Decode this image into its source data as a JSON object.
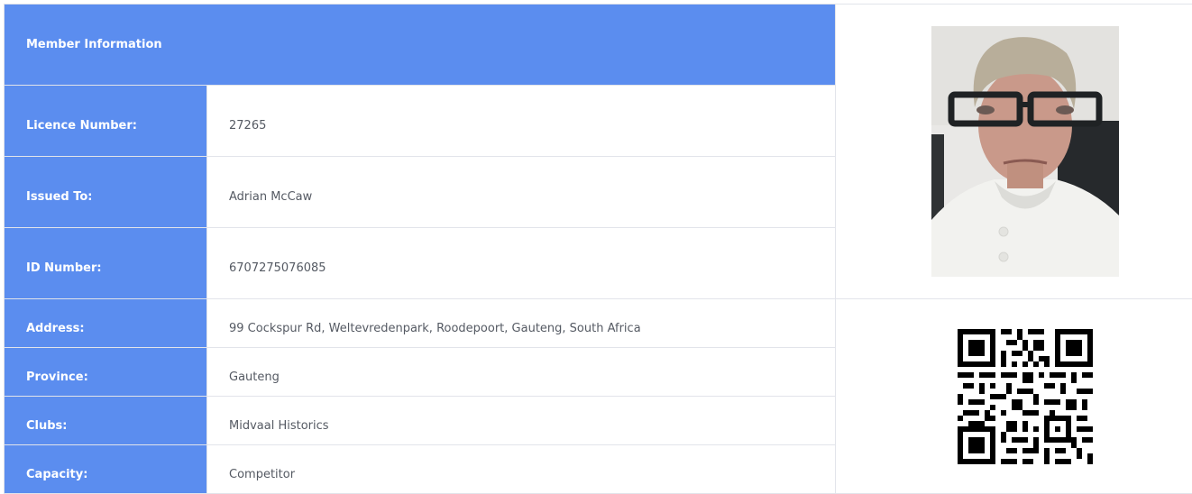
{
  "title": "Member Information",
  "rows": [
    {
      "label": "Licence Number:",
      "value": "27265"
    },
    {
      "label": "Issued To:",
      "value": "Adrian McCaw"
    },
    {
      "label": "ID Number:",
      "value": "6707275076085"
    },
    {
      "label": "Address:",
      "value": "99 Cockspur Rd, Weltevredenpark, Roodepoort, Gauteng, South Africa"
    },
    {
      "label": "Province:",
      "value": "Gauteng"
    },
    {
      "label": "Clubs:",
      "value": "Midvaal Historics"
    },
    {
      "label": "Capacity:",
      "value": "Competitor"
    }
  ],
  "colors": {
    "accent": "#5b8def",
    "label_text": "#ffffff",
    "value_text": "#555a63",
    "border": "#e2e4ea"
  },
  "icons": {
    "photo": "member-photo",
    "qr": "qr-code"
  }
}
